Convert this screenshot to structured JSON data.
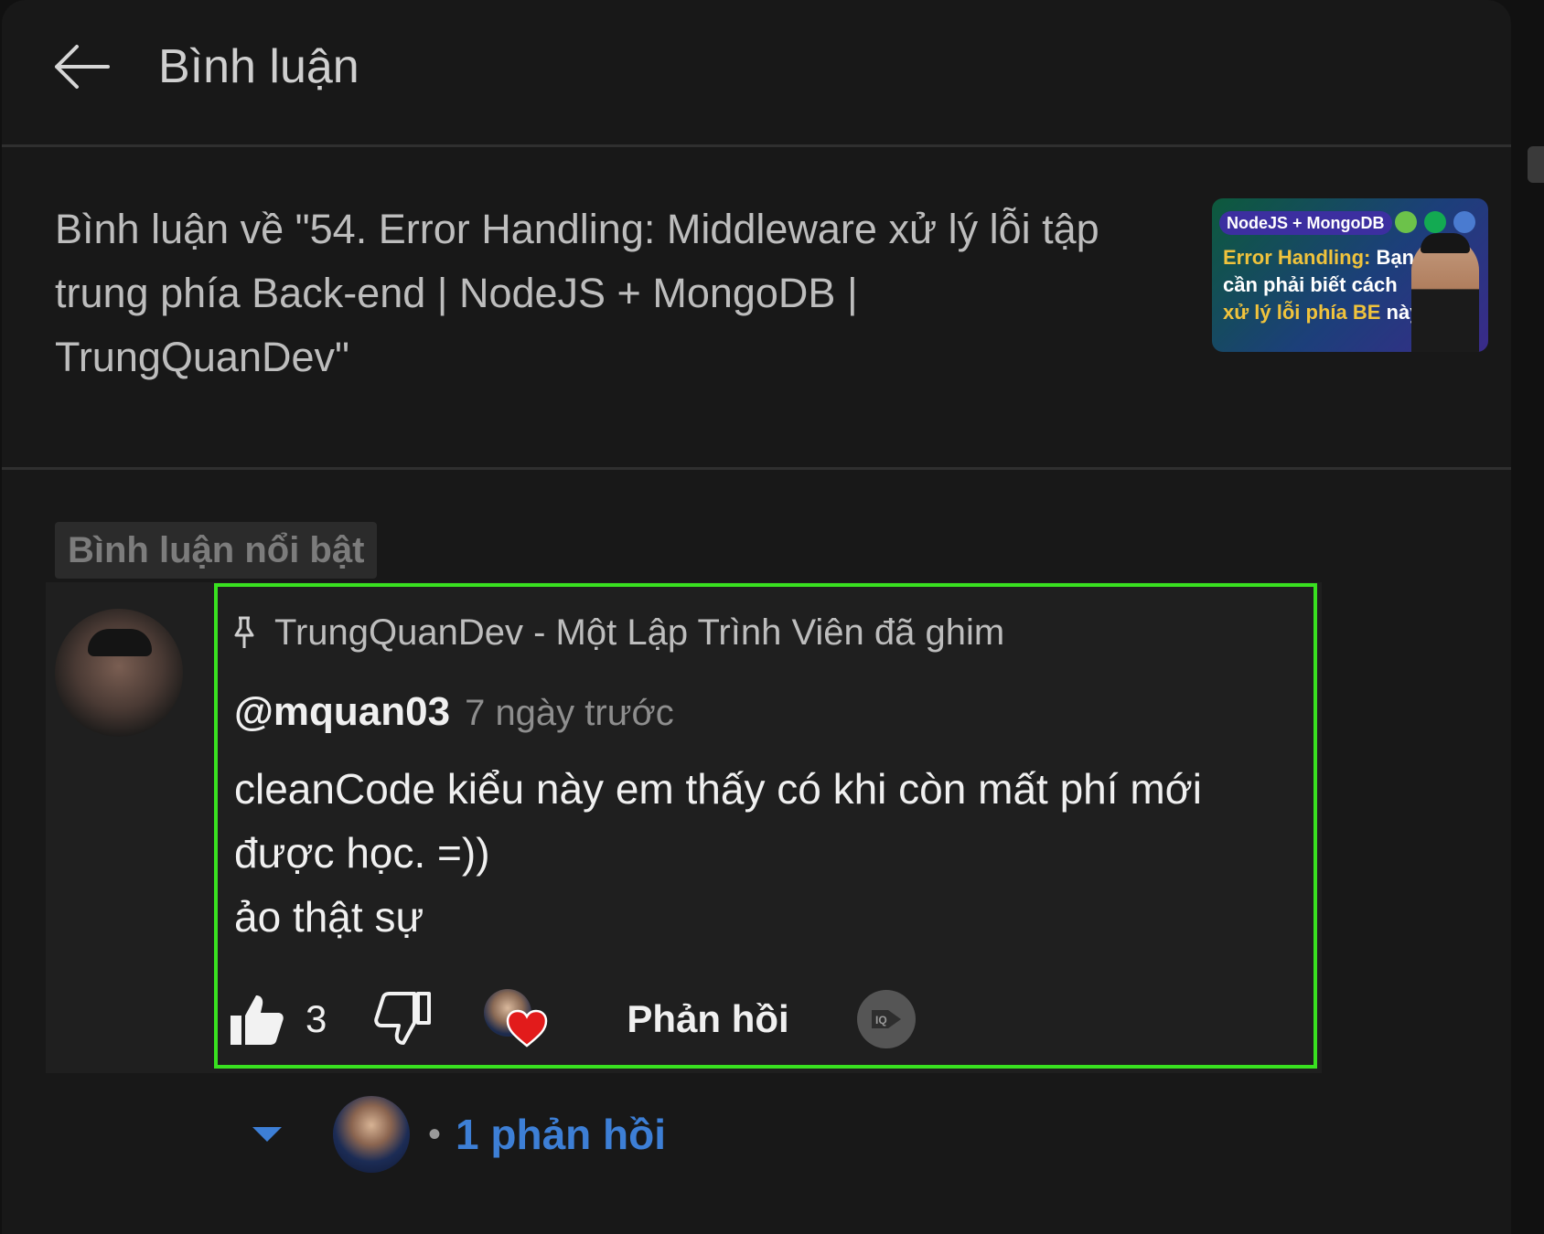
{
  "header": {
    "back_icon": "arrow-left-icon",
    "title": "Bình luận"
  },
  "video": {
    "title": "Bình luận về \"54. Error Handling: Middleware xử lý lỗi tập trung phía Back-end | NodeJS + MongoDB | TrungQuanDev\"",
    "thumbnail": {
      "tag": "NodeJS + MongoDB",
      "line1_accent": "Error Handling:",
      "line1_rest": " Bạn",
      "line2": "cần phải biết cách",
      "line3_accent": "xử lý lỗi phía BE",
      "line3_rest": " này"
    }
  },
  "section_label": "Bình luận nổi bật",
  "comment": {
    "pinned_icon": "pin-icon",
    "pinned_text": "TrungQuanDev - Một Lập Trình Viên đã ghim",
    "author": "@mquan03",
    "timestamp": "7 ngày trước",
    "lines": [
      "cleanCode kiểu này em thấy có khi còn mất phí mới",
      "được học. =))",
      "ảo thật sự"
    ],
    "like_count": "3",
    "reply_label": "Phản hồi"
  },
  "replies": {
    "count_label": "1 phản hồi",
    "separator": "•"
  },
  "colors": {
    "background": "#181818",
    "highlight_border": "#39e120",
    "reply_link": "#3d7fd6",
    "heart": "#e21b1b"
  }
}
